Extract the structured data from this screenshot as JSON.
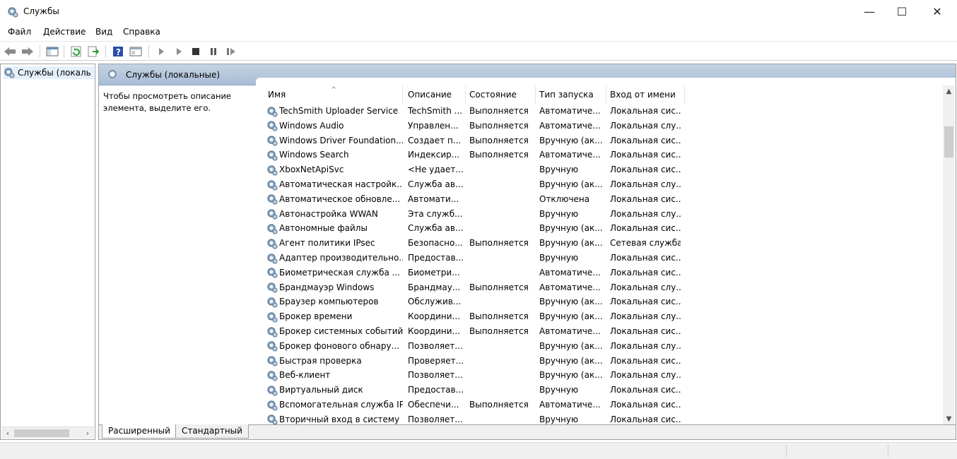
{
  "window": {
    "title": "Службы",
    "icon": "services-gear-icon",
    "controls": {
      "minimize": "—",
      "maximize": "☐",
      "close": "✕"
    }
  },
  "menu": [
    "Файл",
    "Действие",
    "Вид",
    "Справка"
  ],
  "toolbar": {
    "buttons": [
      "back-arrow-icon",
      "forward-arrow-icon",
      "show-hide-console-tree-icon",
      "refresh-icon",
      "export-list-icon",
      "help-icon",
      "properties-icon",
      "start-service-icon",
      "start-alt-icon",
      "stop-service-icon",
      "pause-service-icon",
      "resume-service-icon"
    ]
  },
  "tree": {
    "item": "Службы (локаль"
  },
  "pane": {
    "header": "Службы (локальные)",
    "description": "Чтобы просмотреть описание элемента, выделите его."
  },
  "columns": [
    "Имя",
    "Описание",
    "Состояние",
    "Тип запуска",
    "Вход от имени"
  ],
  "services": [
    {
      "name": "TechSmith Uploader Service",
      "desc": "TechSmith ...",
      "state": "Выполняется",
      "start": "Автоматиче...",
      "logon": "Локальная сис..."
    },
    {
      "name": "Windows Audio",
      "desc": "Управлен...",
      "state": "Выполняется",
      "start": "Автоматиче...",
      "logon": "Локальная слу..."
    },
    {
      "name": "Windows Driver Foundation...",
      "desc": "Создает п...",
      "state": "Выполняется",
      "start": "Вручную (ак...",
      "logon": "Локальная сис..."
    },
    {
      "name": "Windows Search",
      "desc": "Индексир...",
      "state": "Выполняется",
      "start": "Автоматиче...",
      "logon": "Локальная сис..."
    },
    {
      "name": "XboxNetApiSvc",
      "desc": "<Не удает...",
      "state": "",
      "start": "Вручную",
      "logon": "Локальная сис..."
    },
    {
      "name": "Автоматическая настройк...",
      "desc": "Служба ав...",
      "state": "",
      "start": "Вручную (ак...",
      "logon": "Локальная слу..."
    },
    {
      "name": "Автоматическое обновле...",
      "desc": "Автомати...",
      "state": "",
      "start": "Отключена",
      "logon": "Локальная сис..."
    },
    {
      "name": "Автонастройка WWAN",
      "desc": "Эта служб...",
      "state": "",
      "start": "Вручную",
      "logon": "Локальная слу..."
    },
    {
      "name": "Автономные файлы",
      "desc": "Служба ав...",
      "state": "",
      "start": "Вручную (ак...",
      "logon": "Локальная сис..."
    },
    {
      "name": "Агент политики IPsec",
      "desc": "Безопасно...",
      "state": "Выполняется",
      "start": "Вручную (ак...",
      "logon": "Сетевая служба"
    },
    {
      "name": "Адаптер производительно...",
      "desc": "Предостав...",
      "state": "",
      "start": "Вручную",
      "logon": "Локальная сис..."
    },
    {
      "name": "Биометрическая служба ...",
      "desc": "Биометри...",
      "state": "",
      "start": "Автоматиче...",
      "logon": "Локальная сис..."
    },
    {
      "name": "Брандмауэр Windows",
      "desc": "Брандмау...",
      "state": "Выполняется",
      "start": "Автоматиче...",
      "logon": "Локальная слу..."
    },
    {
      "name": "Браузер компьютеров",
      "desc": "Обслужив...",
      "state": "",
      "start": "Вручную (ак...",
      "logon": "Локальная сис..."
    },
    {
      "name": "Брокер времени",
      "desc": "Координи...",
      "state": "Выполняется",
      "start": "Вручную (ак...",
      "logon": "Локальная слу..."
    },
    {
      "name": "Брокер системных событий",
      "desc": "Координи...",
      "state": "Выполняется",
      "start": "Автоматиче...",
      "logon": "Локальная сис..."
    },
    {
      "name": "Брокер фонового обнару...",
      "desc": "Позволяет...",
      "state": "",
      "start": "Вручную (ак...",
      "logon": "Локальная слу..."
    },
    {
      "name": "Быстрая проверка",
      "desc": "Проверяет...",
      "state": "",
      "start": "Вручную (ак...",
      "logon": "Локальная сис..."
    },
    {
      "name": "Веб-клиент",
      "desc": "Позволяет...",
      "state": "",
      "start": "Вручную (ак...",
      "logon": "Локальная слу..."
    },
    {
      "name": "Виртуальный диск",
      "desc": "Предостав...",
      "state": "",
      "start": "Вручную",
      "logon": "Локальная сис..."
    },
    {
      "name": "Вспомогательная служба IP",
      "desc": "Обеспечи...",
      "state": "Выполняется",
      "start": "Автоматиче...",
      "logon": "Локальная сис..."
    },
    {
      "name": "Вторичный вход в систему",
      "desc": "Позволяет...",
      "state": "",
      "start": "Вручную",
      "logon": "Локальная сис..."
    }
  ],
  "tabs": [
    "Расширенный",
    "Стандартный"
  ],
  "colors": {
    "header_bg": "#b4c6dc",
    "selection": "#e5f0fb",
    "chrome": "#f0f0f0"
  }
}
